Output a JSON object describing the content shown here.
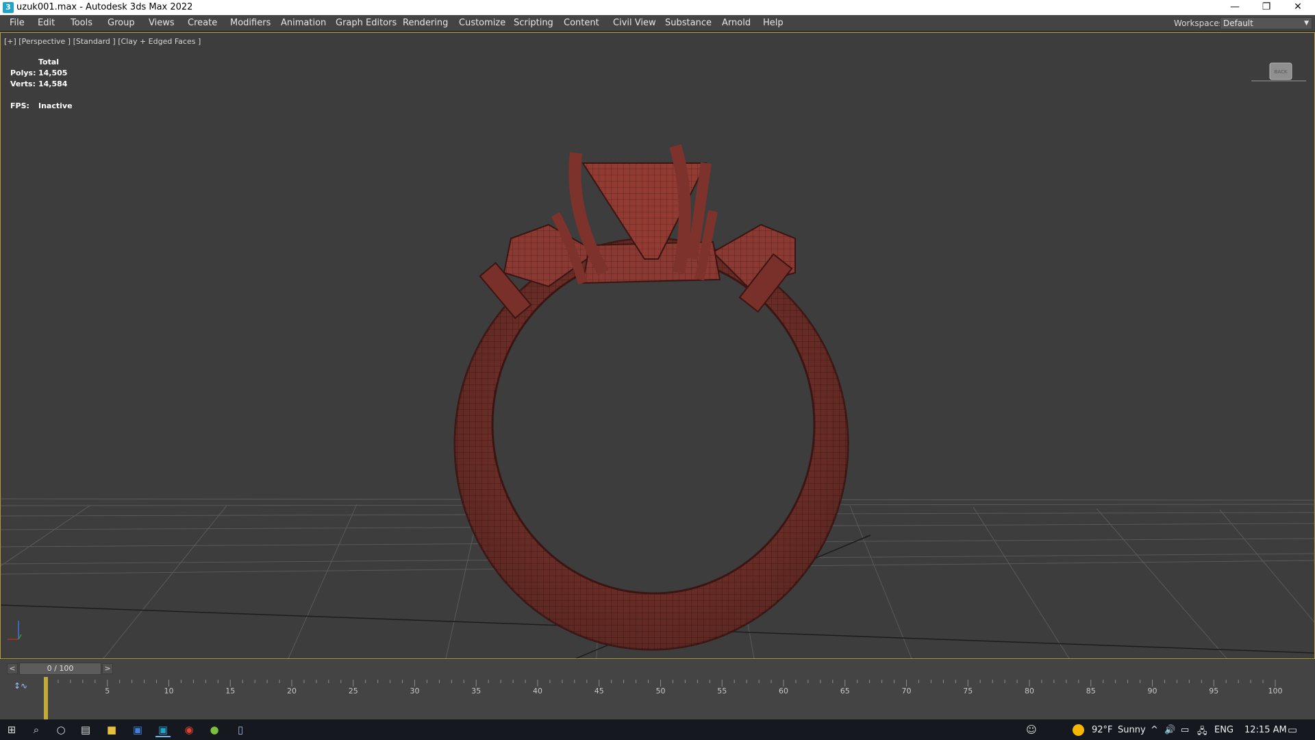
{
  "window": {
    "title": "uzuk001.max - Autodesk 3ds Max 2022",
    "app_icon": "3",
    "minimize_icon": "—",
    "restore_icon": "❐",
    "close_icon": "✕"
  },
  "menu": {
    "items": [
      "File",
      "Edit",
      "Tools",
      "Group",
      "Views",
      "Create",
      "Modifiers",
      "Animation",
      "Graph Editors",
      "Rendering",
      "Customize",
      "Scripting",
      "Content",
      "Civil View",
      "Substance",
      "Arnold",
      "Help"
    ],
    "workspace_label": "Workspaces:",
    "workspace_value": "Default"
  },
  "viewport": {
    "label": "[+] [Perspective ] [Standard ] [Clay + Edged Faces ]",
    "stats": {
      "total_label": "Total",
      "polys_label": "Polys:",
      "polys_value": "14,505",
      "verts_label": "Verts:",
      "verts_value": "14,584",
      "fps_label": "FPS:",
      "fps_value": "Inactive"
    },
    "viewcube_label": "BACK",
    "model_color": "#8a3a32",
    "border_color": "#b59d3a"
  },
  "timeline": {
    "prev": "<",
    "next": ">",
    "position": "0 / 100",
    "current_frame": 0,
    "ticks": [
      "5",
      "10",
      "15",
      "20",
      "25",
      "30",
      "35",
      "40",
      "45",
      "50",
      "55",
      "60",
      "65",
      "70",
      "75",
      "80",
      "85",
      "90",
      "95",
      "100"
    ]
  },
  "taskbar": {
    "start_icon": "windows-start-icon",
    "weather_temp": "92°F",
    "weather_desc": "Sunny",
    "language": "ENG",
    "time": "12:15 AM",
    "tray_glyphs": [
      "^",
      "🔊",
      "▭",
      "🖧"
    ]
  }
}
